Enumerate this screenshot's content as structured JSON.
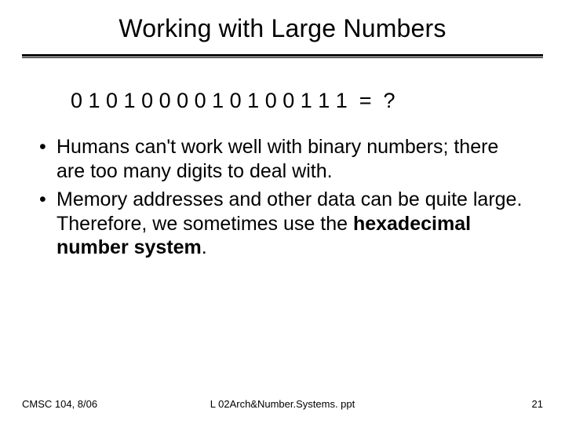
{
  "title": "Working with Large Numbers",
  "binary_line": "0 1 0 1 0 0 0 0 1 0 1 0 0 1 1 1  =  ?",
  "bullets": [
    {
      "pre": "Humans can't work well with binary numbers; there are too many digits to deal with.",
      "bold": "",
      "post": ""
    },
    {
      "pre": "Memory addresses and other data can be quite large.  Therefore, we sometimes use the ",
      "bold": "hexadecimal number system",
      "post": "."
    }
  ],
  "footer": {
    "left": "CMSC 104, 8/06",
    "center": "L 02Arch&Number.Systems. ppt",
    "right": "21"
  }
}
